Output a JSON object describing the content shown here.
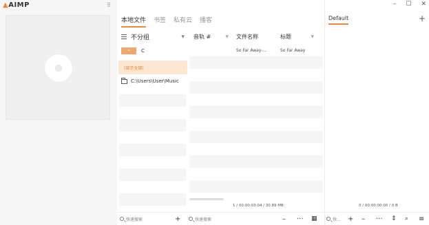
{
  "app": {
    "logo_text": "AIMP"
  },
  "tabs": [
    {
      "label": "本地文件",
      "active": true
    },
    {
      "label": "书签"
    },
    {
      "label": "私有云"
    },
    {
      "label": "播客"
    }
  ],
  "groups": {
    "header_label": "不分组",
    "items": [
      {
        "badge": "*",
        "label": "C"
      },
      {
        "label": "(显示全部)",
        "selected": true
      },
      {
        "label": "C:\\Users\\User\\Music"
      }
    ]
  },
  "table": {
    "columns": [
      "音轨 #",
      "文件名称",
      "标题"
    ],
    "rows": [
      {
        "track": "",
        "filename": "So Far Away-...",
        "title": "So Far Away"
      }
    ]
  },
  "status": {
    "library": "1 / 00:00:03:04 / 30.89 MB",
    "playlist": "0 / 00:00:00:00 / 0 B"
  },
  "playlist": {
    "tab_label": "Default"
  },
  "search": {
    "left_placeholder": "快速搜索",
    "mid_placeholder": "快速搜索",
    "right_placeholder": "快..."
  },
  "window": {
    "minimize": "–",
    "maximize": "☐",
    "close": "✕"
  },
  "colors": {
    "accent": "#f0883a"
  }
}
